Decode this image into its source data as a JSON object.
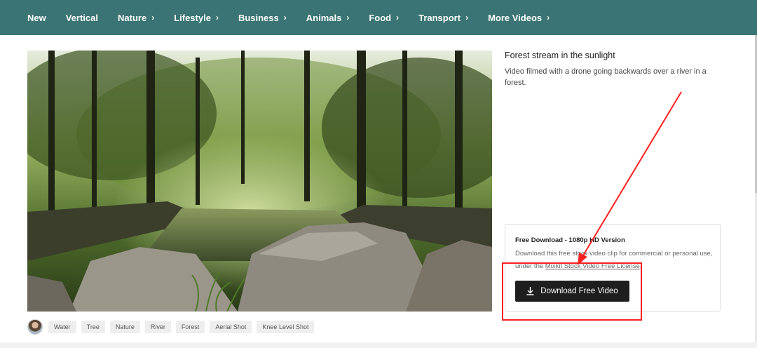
{
  "nav": {
    "items": [
      {
        "label": "New",
        "chevron": ""
      },
      {
        "label": "Vertical",
        "chevron": ""
      },
      {
        "label": "Nature",
        "chevron": "›"
      },
      {
        "label": "Lifestyle",
        "chevron": "›"
      },
      {
        "label": "Business",
        "chevron": "›"
      },
      {
        "label": "Animals",
        "chevron": "›"
      },
      {
        "label": "Food",
        "chevron": "›"
      },
      {
        "label": "Transport",
        "chevron": "›"
      },
      {
        "label": "More Videos",
        "chevron": "›"
      }
    ],
    "background": "#3a7474"
  },
  "video": {
    "title": "Forest stream in the sunlight",
    "description": "Video filmed with a drone going backwards over a river in a forest."
  },
  "tags": [
    "Water",
    "Tree",
    "Nature",
    "River",
    "Forest",
    "Aerial Shot",
    "Knee Level Shot"
  ],
  "download": {
    "title": "Free Download - 1080p HD Version",
    "text_before": "Download this free stock video clip for commercial or personal use, under the ",
    "license_link": "Mixkit Stock Video Free License",
    "text_after": ".",
    "button_label": "Download Free Video",
    "button_icon": "download-icon"
  },
  "annotation": {
    "color": "#ff2020"
  }
}
